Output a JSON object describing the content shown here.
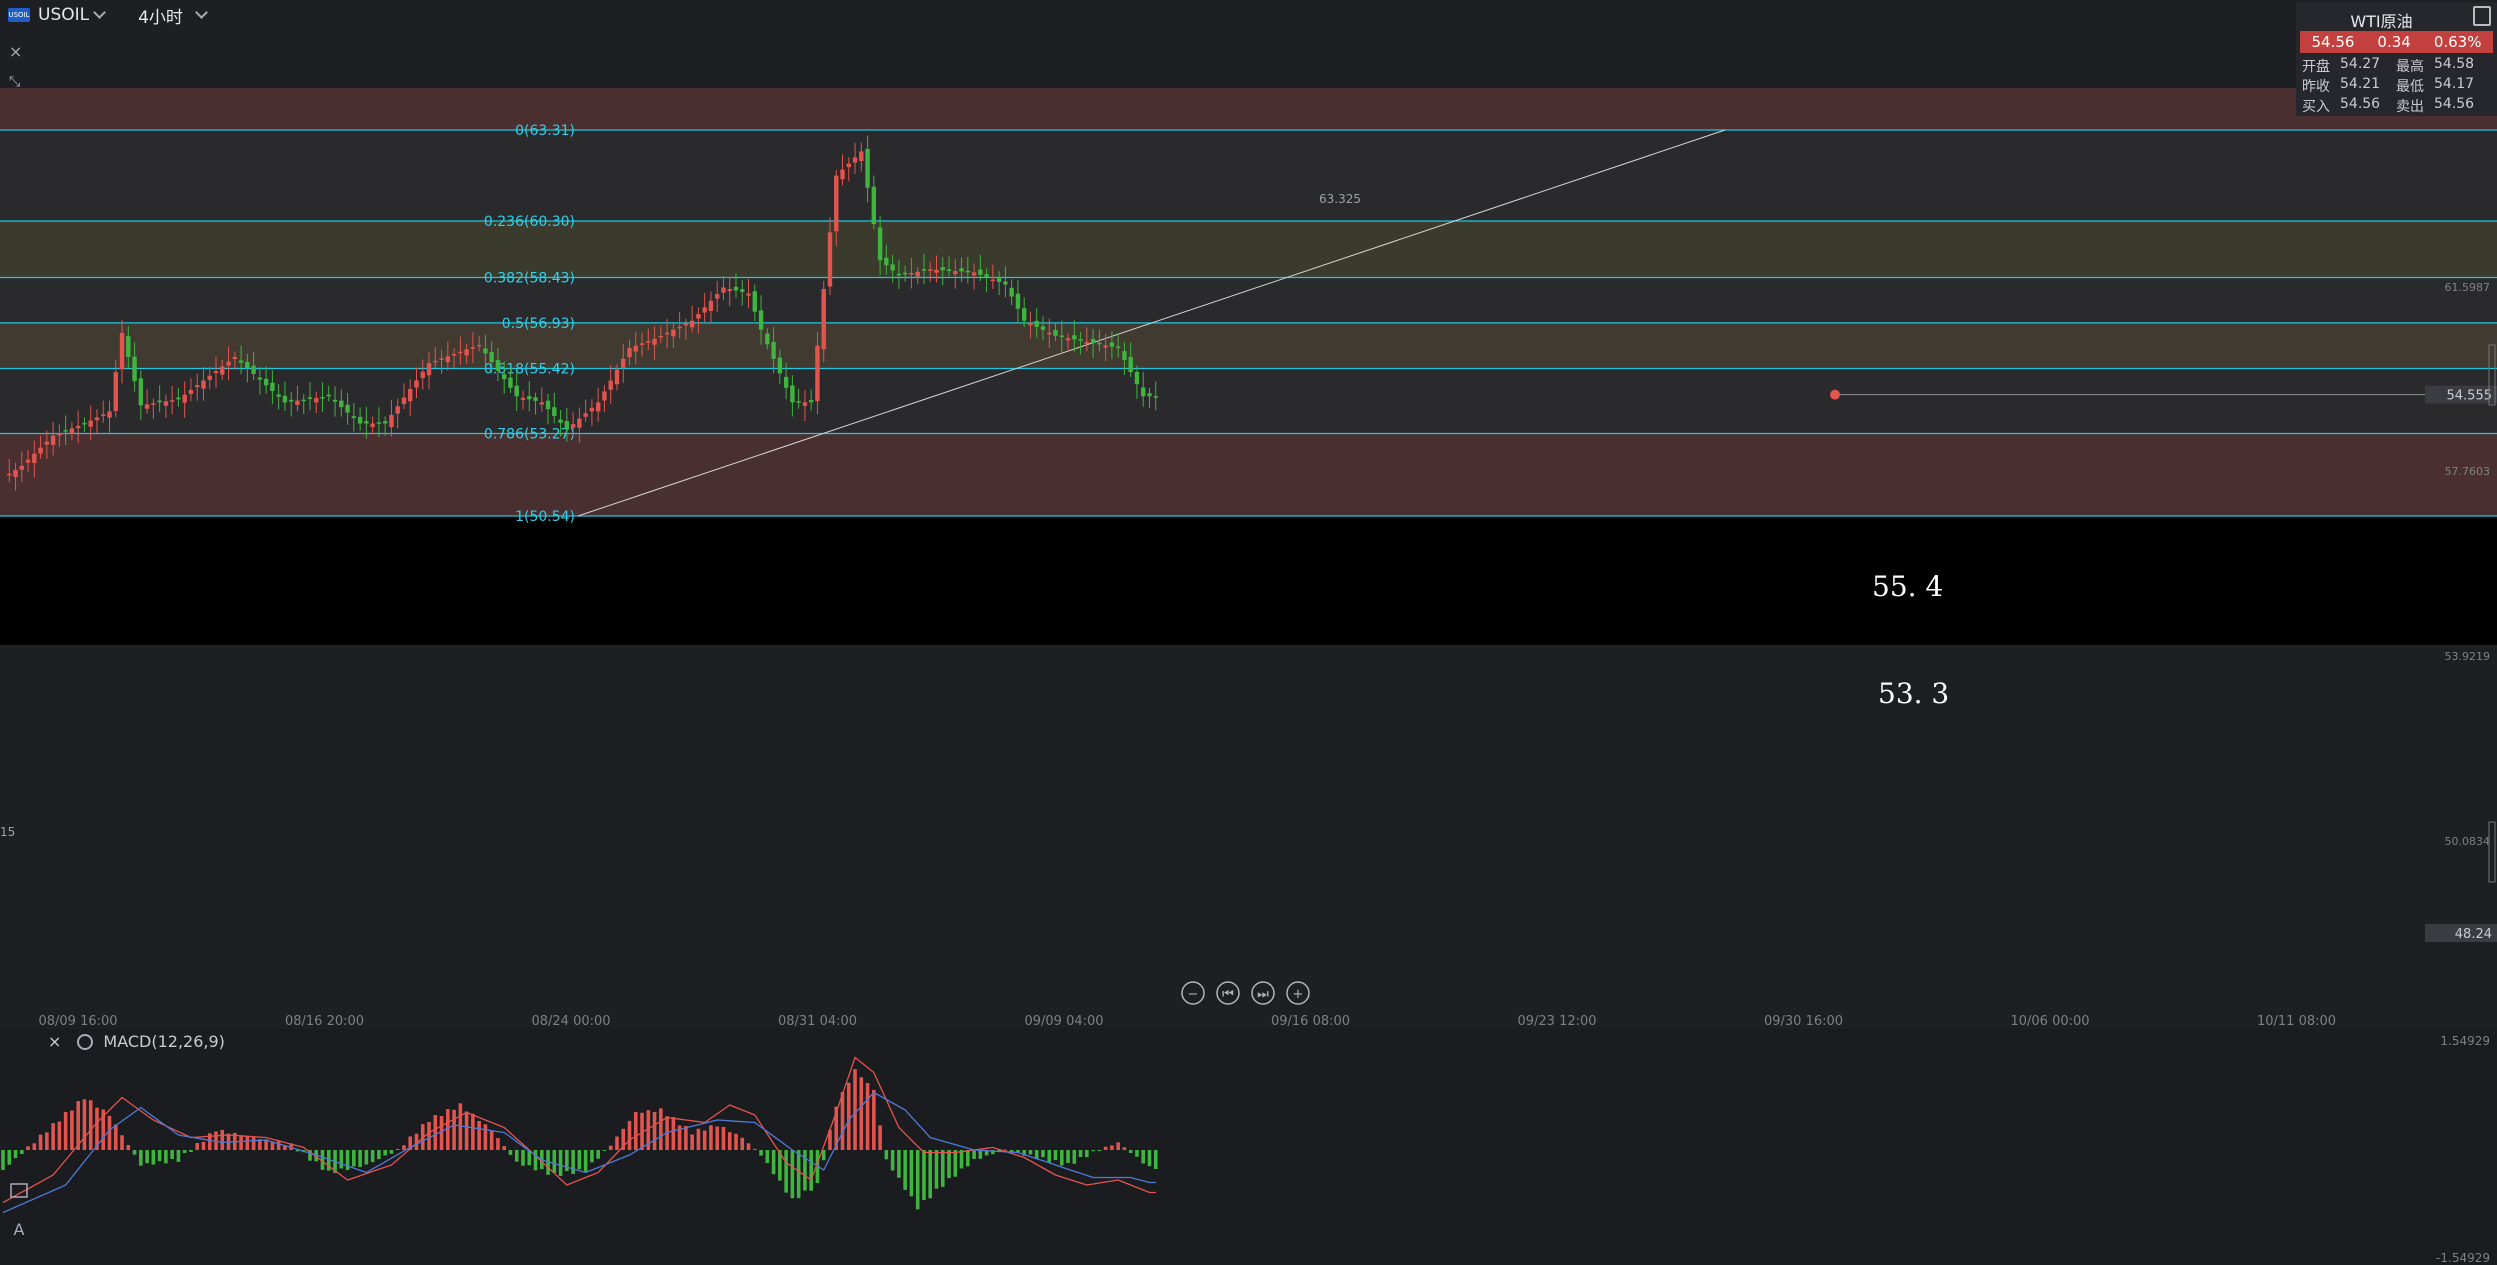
{
  "toolbar": {
    "symbol": "USOIL",
    "logo_text": "USOIL",
    "timeframe": "4小时",
    "close_icon": "×",
    "expand_icon": "⤡"
  },
  "quote_panel": {
    "title": "WTI原油",
    "price": "54.56",
    "change": "0.34",
    "change_pct": "0.63%",
    "rows": [
      {
        "l1": "开盘",
        "v1": "54.27",
        "l2": "最高",
        "v2": "54.58"
      },
      {
        "l1": "昨收",
        "v1": "54.21",
        "l2": "最低",
        "v2": "54.17"
      },
      {
        "l1": "买入",
        "v1": "54.56",
        "l2": "卖出",
        "v2": "54.56"
      }
    ]
  },
  "colors": {
    "up": "#e2544e",
    "down": "#3fb43f",
    "fib_line": "#1fc8e0",
    "fib_text": "#2fd0ea",
    "background": "#1e1f23"
  },
  "annotations": {
    "upper": "55. 4",
    "lower": "53. 3"
  },
  "chart_data": [
    {
      "type": "candlestick",
      "symbol": "USOIL",
      "timeframe": "4小时",
      "y_range": [
        47.8,
        64.5
      ],
      "x_ticks": [
        "08/09 16:00",
        "08/16 20:00",
        "08/24 00:00",
        "08/31 04:00",
        "09/09 04:00",
        "09/16 08:00",
        "09/23 12:00",
        "09/30 16:00",
        "10/06 00:00",
        "10/11 08:00"
      ],
      "y_ticks": [
        "61.5987",
        "57.7603",
        "53.9219",
        "50.0834"
      ],
      "peak_label": "63.325",
      "left_edge_label": "15",
      "current_price": "54.555",
      "marker_price": "48.24",
      "anchors": [
        [
          0,
          51.8
        ],
        [
          3,
          52.2
        ],
        [
          8,
          53.2
        ],
        [
          13,
          53.6
        ],
        [
          17,
          54.0
        ],
        [
          19,
          56.6
        ],
        [
          22,
          54.2
        ],
        [
          28,
          54.4
        ],
        [
          37,
          55.8
        ],
        [
          45,
          54.3
        ],
        [
          52,
          54.5
        ],
        [
          57,
          53.6
        ],
        [
          61,
          53.6
        ],
        [
          68,
          55.6
        ],
        [
          76,
          56.2
        ],
        [
          82,
          54.5
        ],
        [
          86,
          54.3
        ],
        [
          90,
          53.4
        ],
        [
          95,
          54.3
        ],
        [
          100,
          56.1
        ],
        [
          104,
          56.4
        ],
        [
          110,
          57.0
        ],
        [
          115,
          58.1
        ],
        [
          119,
          57.9
        ],
        [
          121,
          56.7
        ],
        [
          126,
          54.3
        ],
        [
          129,
          54.3
        ],
        [
          133,
          61.8
        ],
        [
          137,
          62.6
        ],
        [
          140,
          59.0
        ],
        [
          143,
          58.5
        ],
        [
          148,
          58.7
        ],
        [
          155,
          58.6
        ],
        [
          160,
          58.2
        ],
        [
          163,
          57.0
        ],
        [
          168,
          56.5
        ],
        [
          173,
          56.3
        ],
        [
          178,
          56.1
        ],
        [
          182,
          54.5
        ],
        [
          184,
          54.5
        ]
      ],
      "fib_levels": [
        {
          "label": "0(63.31)",
          "price": 63.31
        },
        {
          "label": "0.236(60.30)",
          "price": 60.3
        },
        {
          "label": "0.382(58.43)",
          "price": 58.43
        },
        {
          "label": "0.5(56.93)",
          "price": 56.93
        },
        {
          "label": "0.618(55.42)",
          "price": 55.42
        },
        {
          "label": "0.786(53.27)",
          "price": 53.27
        },
        {
          "label": "1(50.54)",
          "price": 50.54
        }
      ],
      "fib_zone_colors": [
        "#4a2f30",
        "#2a2a2c",
        "#3a3b2c",
        "#2a2a2c",
        "#403a31",
        "#2a2a2c",
        "#4a2f30"
      ],
      "trendline": {
        "from_price": 50.54,
        "to_price": 63.31
      }
    },
    {
      "type": "macd",
      "title": "MACD(12,26,9)",
      "y_ticks": [
        "1.54929",
        "-1.54929"
      ],
      "hist_anchors": [
        [
          0,
          -0.4
        ],
        [
          8,
          0.5
        ],
        [
          13,
          1.05
        ],
        [
          17,
          0.7
        ],
        [
          22,
          -0.3
        ],
        [
          28,
          -0.2
        ],
        [
          34,
          0.4
        ],
        [
          40,
          0.25
        ],
        [
          46,
          0.1
        ],
        [
          52,
          -0.45
        ],
        [
          58,
          -0.3
        ],
        [
          63,
          0.0
        ],
        [
          68,
          0.6
        ],
        [
          73,
          0.9
        ],
        [
          78,
          0.4
        ],
        [
          82,
          -0.25
        ],
        [
          88,
          -0.5
        ],
        [
          93,
          -0.4
        ],
        [
          97,
          0.1
        ],
        [
          101,
          0.75
        ],
        [
          105,
          0.8
        ],
        [
          110,
          0.35
        ],
        [
          114,
          0.5
        ],
        [
          118,
          0.25
        ],
        [
          121,
          -0.1
        ],
        [
          126,
          -1.0
        ],
        [
          130,
          -0.7
        ],
        [
          133,
          0.9
        ],
        [
          136,
          1.6
        ],
        [
          139,
          1.2
        ],
        [
          141,
          -0.2
        ],
        [
          146,
          -1.15
        ],
        [
          150,
          -0.7
        ],
        [
          155,
          -0.2
        ],
        [
          160,
          0.0
        ],
        [
          165,
          -0.15
        ],
        [
          170,
          -0.3
        ],
        [
          174,
          -0.05
        ],
        [
          178,
          0.15
        ],
        [
          183,
          -0.35
        ]
      ],
      "macd_anchors": [
        [
          0,
          -1.05
        ],
        [
          8,
          -0.5
        ],
        [
          15,
          0.55
        ],
        [
          19,
          1.05
        ],
        [
          24,
          0.6
        ],
        [
          30,
          0.25
        ],
        [
          36,
          0.3
        ],
        [
          42,
          0.25
        ],
        [
          48,
          0.05
        ],
        [
          55,
          -0.6
        ],
        [
          62,
          -0.3
        ],
        [
          68,
          0.35
        ],
        [
          74,
          0.75
        ],
        [
          80,
          0.45
        ],
        [
          84,
          0.0
        ],
        [
          90,
          -0.7
        ],
        [
          95,
          -0.45
        ],
        [
          100,
          0.2
        ],
        [
          106,
          0.65
        ],
        [
          112,
          0.55
        ],
        [
          116,
          0.9
        ],
        [
          120,
          0.7
        ],
        [
          125,
          -0.25
        ],
        [
          129,
          -0.6
        ],
        [
          133,
          0.75
        ],
        [
          136,
          1.85
        ],
        [
          139,
          1.55
        ],
        [
          143,
          0.45
        ],
        [
          147,
          -0.05
        ],
        [
          152,
          -0.05
        ],
        [
          158,
          0.05
        ],
        [
          163,
          -0.15
        ],
        [
          168,
          -0.5
        ],
        [
          173,
          -0.7
        ],
        [
          178,
          -0.6
        ],
        [
          183,
          -0.85
        ]
      ],
      "signal_anchors": [
        [
          0,
          -1.25
        ],
        [
          10,
          -0.7
        ],
        [
          17,
          0.4
        ],
        [
          22,
          0.85
        ],
        [
          28,
          0.3
        ],
        [
          35,
          0.15
        ],
        [
          42,
          0.2
        ],
        [
          50,
          -0.1
        ],
        [
          58,
          -0.45
        ],
        [
          65,
          0.05
        ],
        [
          72,
          0.5
        ],
        [
          80,
          0.35
        ],
        [
          86,
          -0.2
        ],
        [
          93,
          -0.45
        ],
        [
          100,
          -0.1
        ],
        [
          106,
          0.35
        ],
        [
          114,
          0.6
        ],
        [
          120,
          0.55
        ],
        [
          126,
          0.0
        ],
        [
          131,
          -0.4
        ],
        [
          135,
          0.6
        ],
        [
          139,
          1.15
        ],
        [
          144,
          0.8
        ],
        [
          148,
          0.25
        ],
        [
          155,
          0.0
        ],
        [
          162,
          -0.05
        ],
        [
          168,
          -0.3
        ],
        [
          174,
          -0.55
        ],
        [
          180,
          -0.55
        ],
        [
          183,
          -0.65
        ]
      ]
    }
  ]
}
